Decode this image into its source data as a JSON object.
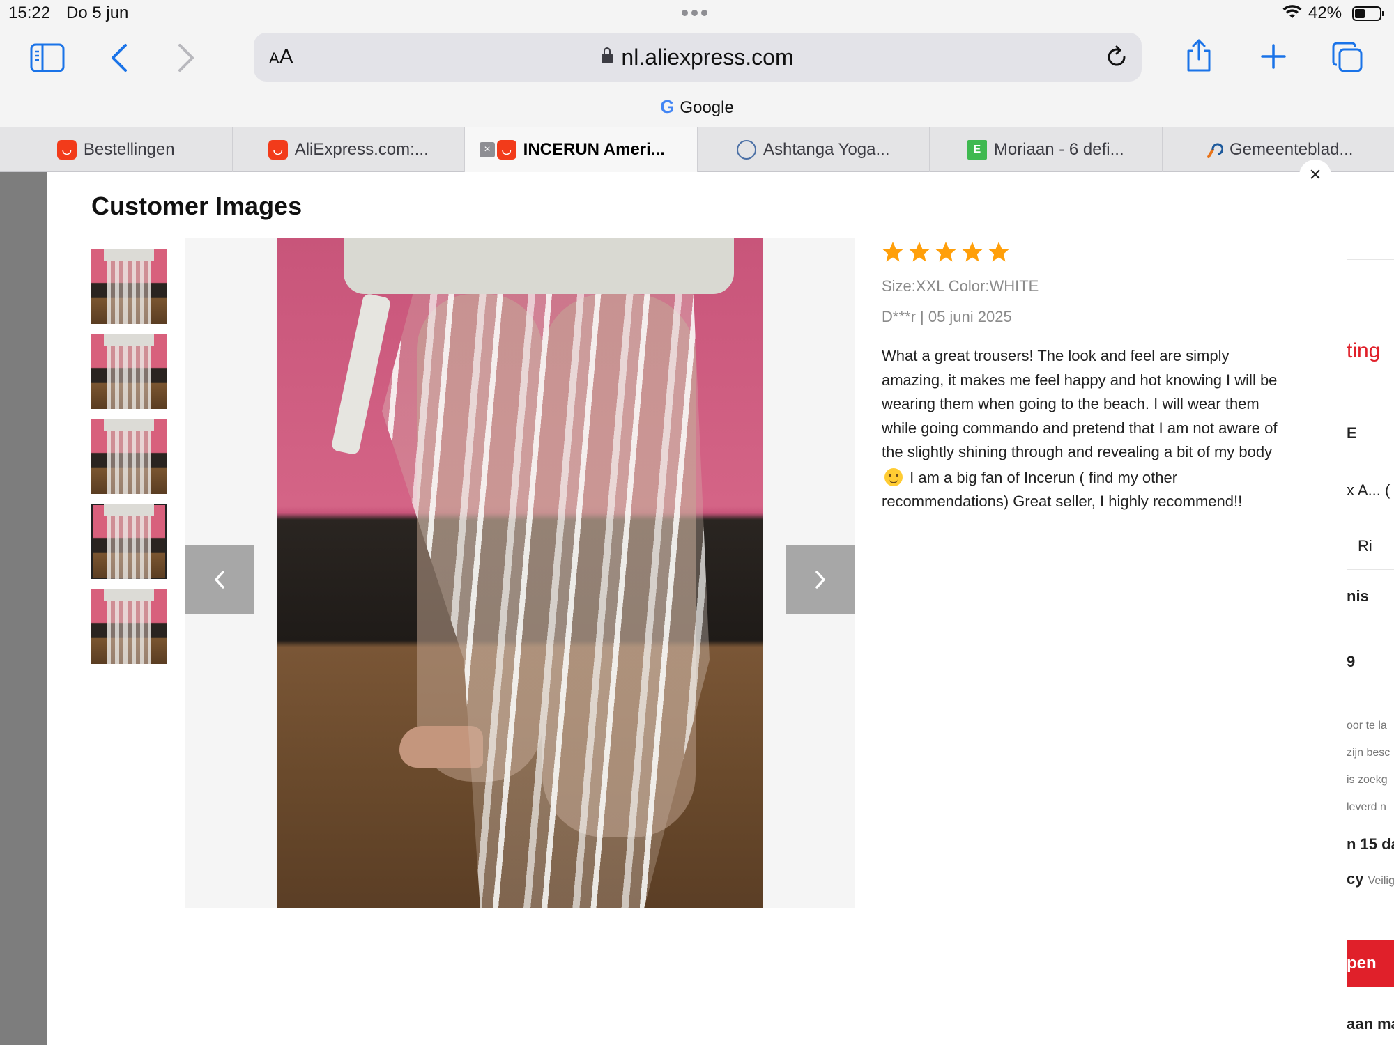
{
  "status_bar": {
    "time": "15:22",
    "date": "Do 5 jun",
    "battery_percent": "42%",
    "battery_level": 0.42
  },
  "toolbar": {
    "text_size_label": "AA",
    "url": "nl.aliexpress.com",
    "search_engine": "Google",
    "icons": [
      "sidebar-icon",
      "back-icon",
      "forward-icon",
      "lock-icon",
      "reload-icon",
      "share-icon",
      "new-tab-icon",
      "tabs-overview-icon"
    ],
    "accent_color": "#1a73e8"
  },
  "tabs": [
    {
      "label": "Bestellingen",
      "favicon": "aliexpress-icon",
      "active": false
    },
    {
      "label": "AliExpress.com:...",
      "favicon": "aliexpress-icon",
      "active": false
    },
    {
      "label": "INCERUN Ameri...",
      "favicon": "aliexpress-icon",
      "active": true
    },
    {
      "label": "Ashtanga Yoga...",
      "favicon": "yoga-icon",
      "active": false
    },
    {
      "label": "Moriaan - 6 defi...",
      "favicon": "e-letter-icon",
      "active": false
    },
    {
      "label": "Gemeenteblad...",
      "favicon": "gemeenteblad-icon",
      "active": false
    }
  ],
  "background_page": {
    "items": [
      "ting",
      "E",
      "x A...  (",
      "Ri",
      "nis",
      "9",
      "oor te la",
      "zijn besc",
      "is zoekg",
      "leverd n",
      "n 15 da",
      "cy",
      "Veilig",
      "pen",
      "aan ma"
    ],
    "brand_color": "#e0202a"
  },
  "modal": {
    "title": "Customer Images",
    "close_label": "×",
    "thumbnail_count": 5,
    "selected_thumbnail": 4,
    "prev_label": "‹",
    "next_label": "›"
  },
  "review": {
    "rating": 5,
    "rating_max": 5,
    "star_color": "#ff9f0a",
    "attributes": "Size:XXL Color:WHITE",
    "author_date": "D***r | 05 juni 2025",
    "text_part1": "What a great trousers! The look and feel are simply amazing, it makes me feel happy and hot knowing I will be wearing them when going to the beach. I will wear them while going commando and pretend that I am not aware of the slightly shining through and revealing a bit of my body",
    "emoji": "smiling-face-emoji",
    "text_part2": " I am a big fan of Incerun ( find my other recommendations)  Great seller, I highly recommend!!"
  }
}
